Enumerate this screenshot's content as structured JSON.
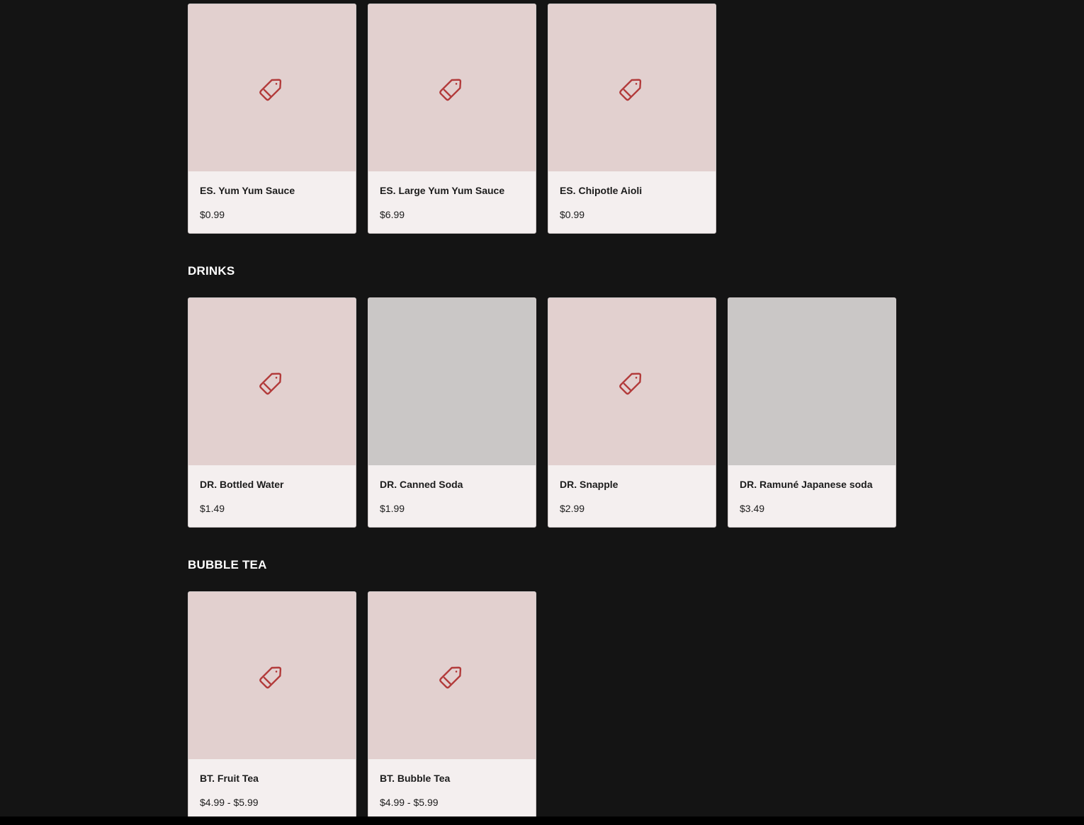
{
  "colors": {
    "page_background": "#141414",
    "card_background": "#f4efef",
    "placeholder_background": "#e2d0cf",
    "photo_background": "#cac7c6",
    "tag_icon": "#b23a3a"
  },
  "sections": [
    {
      "title": "",
      "items": [
        {
          "name": "ES. Yum Yum Sauce",
          "price": "$0.99",
          "image": "tag-icon"
        },
        {
          "name": "ES. Large Yum Yum Sauce",
          "price": "$6.99",
          "image": "tag-icon"
        },
        {
          "name": "ES. Chipotle Aioli",
          "price": "$0.99",
          "image": "tag-icon"
        }
      ]
    },
    {
      "title": "DRINKS",
      "items": [
        {
          "name": "DR. Bottled Water",
          "price": "$1.49",
          "image": "tag-icon"
        },
        {
          "name": "DR. Canned Soda",
          "price": "$1.99",
          "image": "photo"
        },
        {
          "name": "DR. Snapple",
          "price": "$2.99",
          "image": "tag-icon"
        },
        {
          "name": "DR. Ramuné Japanese soda",
          "price": "$3.49",
          "image": "photo"
        }
      ]
    },
    {
      "title": "BUBBLE TEA",
      "items": [
        {
          "name": "BT. Fruit Tea",
          "price": "$4.99 - $5.99",
          "image": "tag-icon"
        },
        {
          "name": "BT. Bubble Tea",
          "price": "$4.99 - $5.99",
          "image": "tag-icon"
        }
      ]
    }
  ]
}
